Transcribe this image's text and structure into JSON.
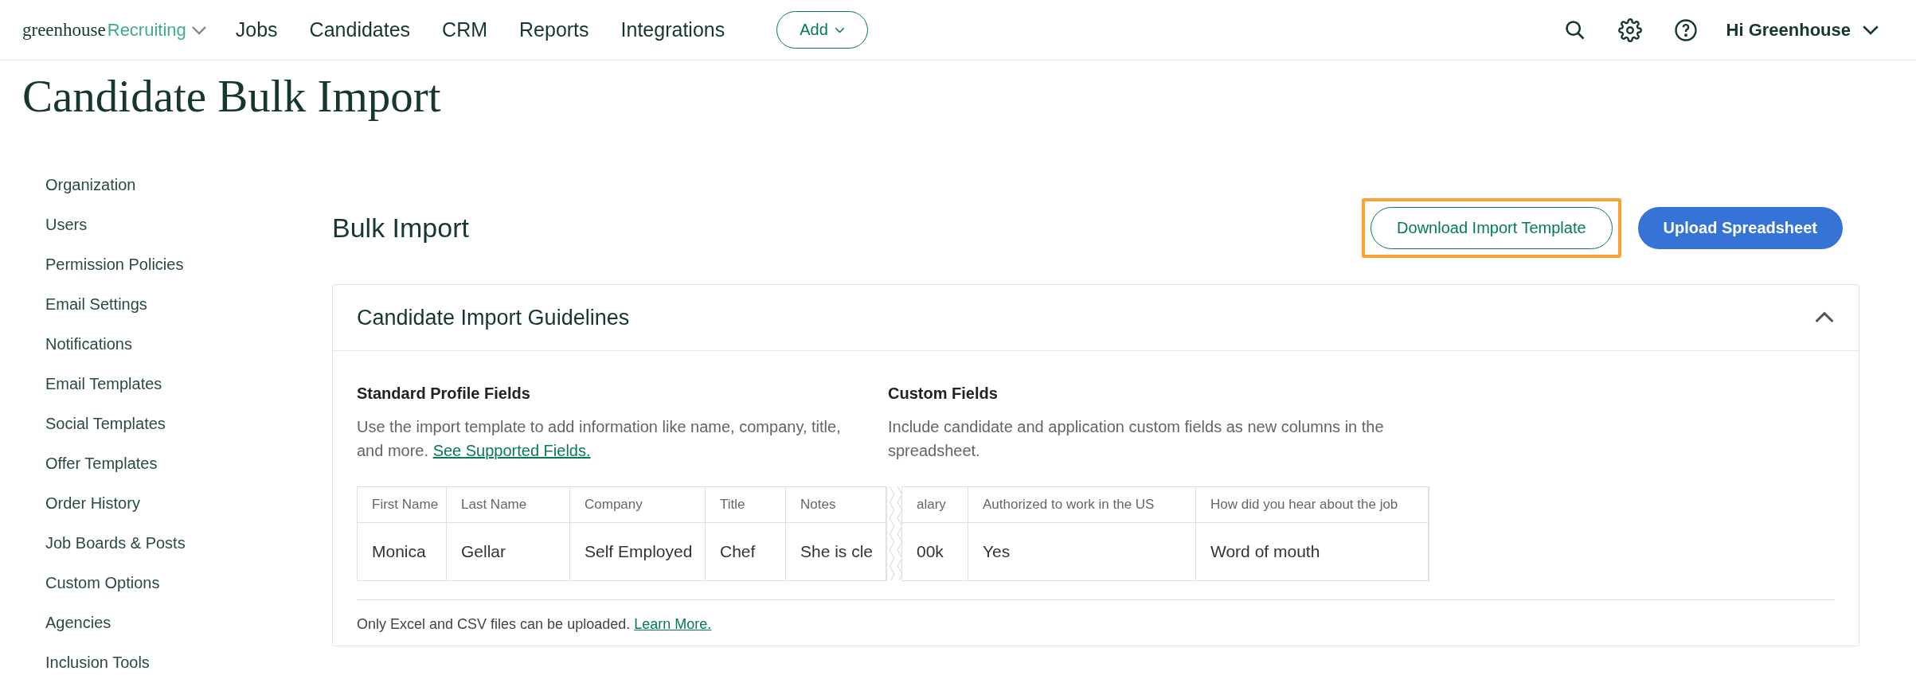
{
  "nav": {
    "logo": {
      "brand": "greenhouse",
      "product": "Recruiting"
    },
    "items": [
      {
        "label": "Jobs"
      },
      {
        "label": "Candidates"
      },
      {
        "label": "CRM"
      },
      {
        "label": "Reports"
      },
      {
        "label": "Integrations"
      }
    ],
    "add_button": "Add",
    "user": "Hi Greenhouse"
  },
  "page_title": "Candidate Bulk Import",
  "sidebar": {
    "items": [
      {
        "label": "Organization"
      },
      {
        "label": "Users"
      },
      {
        "label": "Permission Policies"
      },
      {
        "label": "Email Settings"
      },
      {
        "label": "Notifications"
      },
      {
        "label": "Email Templates"
      },
      {
        "label": "Social Templates"
      },
      {
        "label": "Offer Templates"
      },
      {
        "label": "Order History"
      },
      {
        "label": "Job Boards & Posts"
      },
      {
        "label": "Custom Options"
      },
      {
        "label": "Agencies"
      },
      {
        "label": "Inclusion Tools"
      }
    ]
  },
  "section": {
    "title": "Bulk Import",
    "buttons": [
      {
        "label": "Download Import Template",
        "kind": "outline",
        "highlighted": true
      },
      {
        "label": "Upload Spreadsheet",
        "kind": "primary",
        "highlighted": false
      }
    ]
  },
  "guidelines": {
    "title": "Candidate Import Guidelines",
    "expanded": true,
    "columns": [
      {
        "heading": "Standard Profile Fields",
        "text": "Use the import template to add information like name, company, title, and more.",
        "link": "See Supported Fields."
      },
      {
        "heading": "Custom Fields",
        "text": "Include candidate and application custom fields as new columns in the spreadsheet."
      }
    ],
    "table": {
      "parts": [
        {
          "columns": [
            "First Name",
            "Last Name",
            "Company",
            "Title",
            "Notes"
          ],
          "row": [
            "Monica",
            "Gellar",
            "Self Employed",
            "Chef",
            "She is cle"
          ]
        },
        {
          "columns": [
            "alary",
            "Authorized to work in the US",
            "How did you hear about the job"
          ],
          "row": [
            "00k",
            "Yes",
            "Word of mouth"
          ]
        }
      ]
    },
    "note": "Only Excel and CSV files can be uploaded.",
    "note_link": "Learn More."
  }
}
